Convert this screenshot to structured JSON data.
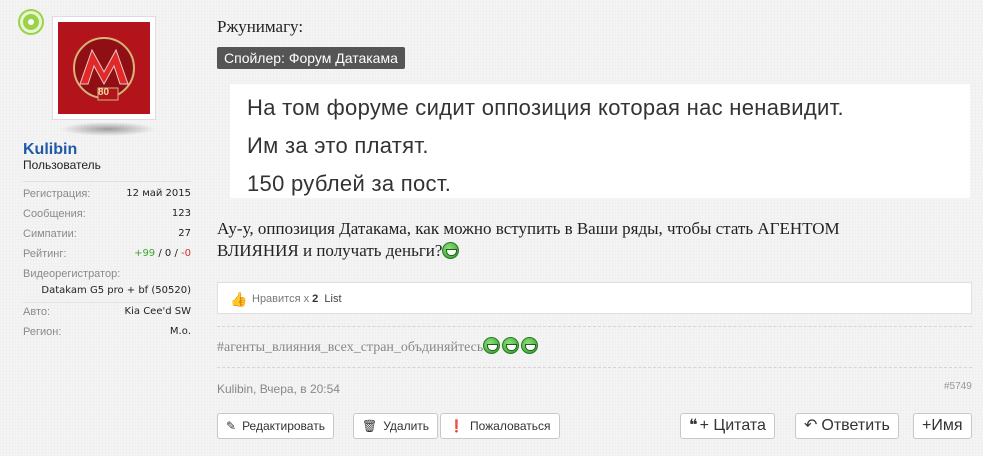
{
  "user": {
    "name": "Kulibin",
    "title": "Пользователь",
    "stats": [
      {
        "label": "Регистрация:",
        "value": "12 май 2015"
      },
      {
        "label": "Сообщения:",
        "value": "123"
      },
      {
        "label": "Симпатии:",
        "value": "27"
      }
    ],
    "rating": {
      "label": "Рейтинг:",
      "pos": "+99",
      "sep1": " / ",
      "neutral": "0",
      "sep2": " / ",
      "neg": "-0"
    },
    "dvr_label": "Видеорегистратор:",
    "dvr_value": "Datakam G5 pro + bf (50520)",
    "car": {
      "label": "Авто:",
      "value": "Kia Cee'd SW"
    },
    "region": {
      "label": "Регион:",
      "value": "М.о."
    },
    "avatar_badge": "80"
  },
  "post": {
    "quote_author": "Ржунимагу:",
    "spoiler_label": "Спойлер: Форум Датакама",
    "spoiler_lines": [
      "На том форуме сидит оппозиция которая нас ненавидит.",
      "Им за это платят.",
      "150 рублей за пост."
    ],
    "text_line1": "Ау-у, оппозиция Датакама, как можно вступить в Ваши ряды, чтобы стать АГЕНТОМ",
    "text_line2": "ВЛИЯНИЯ и получать деньги?",
    "likes_prefix": "Нравится х ",
    "likes_count": "2",
    "likes_list": "List",
    "hashtags": "#агенты_влияния_всех_стран_объдиняйтесь",
    "meta_author": "Kulibin",
    "meta_time": ", Вчера, в 20:54",
    "post_number": "#5749"
  },
  "actions": {
    "edit": "Редактировать",
    "delete": "Удалить",
    "report": "Пожаловаться",
    "quote": "+ Цитата",
    "reply": "Ответить",
    "name": "+Имя"
  }
}
